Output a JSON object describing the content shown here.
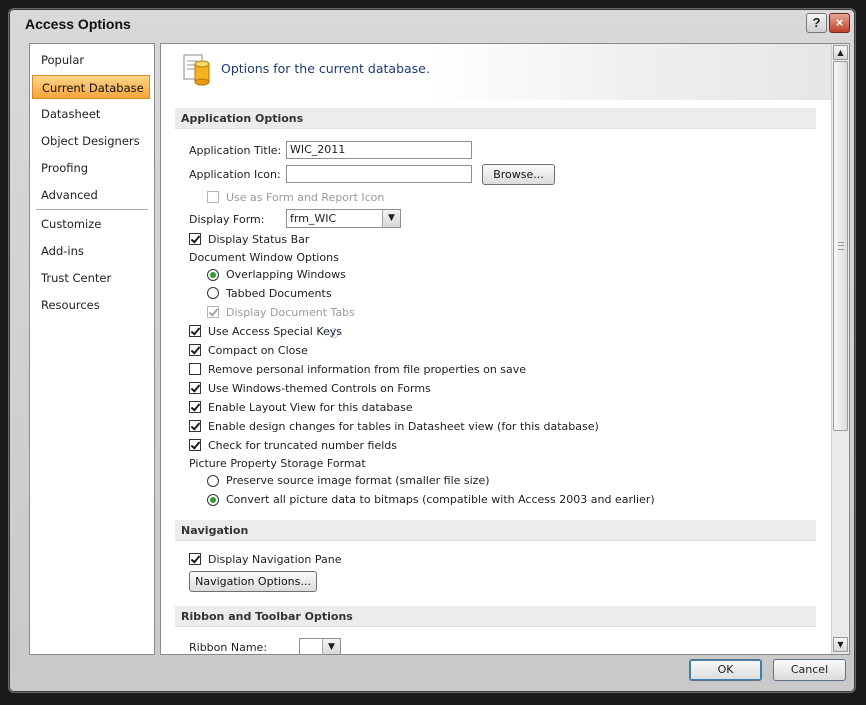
{
  "window": {
    "title": "Access Options",
    "help_label": "?",
    "close_label": "×"
  },
  "sidebar": {
    "items": [
      {
        "label": "Popular"
      },
      {
        "label": "Current Database"
      },
      {
        "label": "Datasheet"
      },
      {
        "label": "Object Designers"
      },
      {
        "label": "Proofing"
      },
      {
        "label": "Advanced"
      },
      {
        "label": "Customize"
      },
      {
        "label": "Add-ins"
      },
      {
        "label": "Trust Center"
      },
      {
        "label": "Resources"
      }
    ],
    "active": "Current Database"
  },
  "header": {
    "text": "Options for the current database."
  },
  "sections": {
    "application": "Application Options",
    "navigation": "Navigation",
    "ribbon": "Ribbon and Toolbar Options"
  },
  "app_options": {
    "title_label": "Application Title:",
    "title_value": "WIC_2011",
    "icon_label": "Application Icon:",
    "icon_value": "",
    "browse_button": "Browse...",
    "use_as_form_icon": "Use as Form and Report Icon",
    "display_form_label": "Display Form:",
    "display_form_value": "frm_WIC",
    "display_status_bar": "Display Status Bar",
    "doc_window_options": "Document Window Options",
    "overlapping": "Overlapping Windows",
    "tabbed": "Tabbed Documents",
    "display_doc_tabs": "Display Document Tabs",
    "special_keys": "Use Access Special Keys",
    "compact_on_close": "Compact on Close",
    "remove_personal": "Remove personal information from file properties on save",
    "windows_themed": "Use Windows-themed Controls on Forms",
    "layout_view": "Enable Layout View for this database",
    "design_changes": "Enable design changes for tables in Datasheet view (for this database)",
    "check_truncated": "Check for truncated number fields",
    "picture_storage": "Picture Property Storage Format",
    "preserve_source": "Preserve source image format (smaller file size)",
    "convert_bitmaps": "Convert all picture data to bitmaps (compatible with Access 2003 and earlier)"
  },
  "navigation": {
    "display_pane": "Display Navigation Pane",
    "options_button": "Navigation Options..."
  },
  "ribbon": {
    "name_label": "Ribbon Name:",
    "name_value": ""
  },
  "footer": {
    "ok": "OK",
    "cancel": "Cancel"
  },
  "icons": {
    "header": "database-options-icon",
    "info": "info-icon",
    "scroll_up": "scroll-up-icon",
    "scroll_down": "scroll-down-icon"
  },
  "colors": {
    "active_tab": "#f9a43a",
    "header_text": "#1c3b72",
    "radio_selected": "#2e9b2e"
  }
}
